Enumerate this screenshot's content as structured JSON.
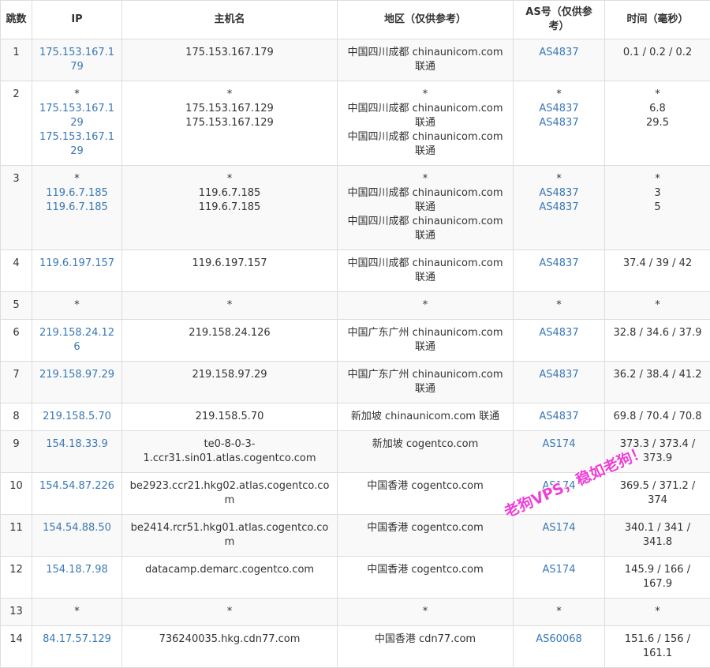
{
  "headers": {
    "hop": "跳数",
    "ip": "IP",
    "host": "主机名",
    "area": "地区（仅供参考）",
    "as": "AS号（仅供参考）",
    "time": "时间（毫秒）"
  },
  "rows": [
    {
      "hop": "1",
      "ip": [
        "175.153.167.179"
      ],
      "host": [
        "175.153.167.179"
      ],
      "area": [
        "中国四川成都 chinaunicom.com 联通"
      ],
      "as": [
        "AS4837"
      ],
      "time": [
        "0.1 / 0.2 / 0.2"
      ]
    },
    {
      "hop": "2",
      "ip": [
        "*",
        "175.153.167.129",
        "175.153.167.129"
      ],
      "host": [
        "*",
        "175.153.167.129",
        "175.153.167.129"
      ],
      "area": [
        "*",
        "中国四川成都 chinaunicom.com 联通",
        "中国四川成都 chinaunicom.com 联通"
      ],
      "as": [
        "*",
        "AS4837",
        "AS4837"
      ],
      "time": [
        "*",
        "6.8",
        "29.5"
      ]
    },
    {
      "hop": "3",
      "ip": [
        "*",
        "119.6.7.185",
        "119.6.7.185"
      ],
      "host": [
        "*",
        "119.6.7.185",
        "119.6.7.185"
      ],
      "area": [
        "*",
        "中国四川成都 chinaunicom.com 联通",
        "中国四川成都 chinaunicom.com 联通"
      ],
      "as": [
        "*",
        "AS4837",
        "AS4837"
      ],
      "time": [
        "*",
        "3",
        "5"
      ]
    },
    {
      "hop": "4",
      "ip": [
        "119.6.197.157"
      ],
      "host": [
        "119.6.197.157"
      ],
      "area": [
        "中国四川成都 chinaunicom.com 联通"
      ],
      "as": [
        "AS4837"
      ],
      "time": [
        "37.4 / 39 / 42"
      ]
    },
    {
      "hop": "5",
      "ip": [
        "*"
      ],
      "host": [
        "*"
      ],
      "area": [
        "*"
      ],
      "as": [
        "*"
      ],
      "time": [
        "*"
      ]
    },
    {
      "hop": "6",
      "ip": [
        "219.158.24.126"
      ],
      "host": [
        "219.158.24.126"
      ],
      "area": [
        "中国广东广州 chinaunicom.com 联通"
      ],
      "as": [
        "AS4837"
      ],
      "time": [
        "32.8 / 34.6 / 37.9"
      ]
    },
    {
      "hop": "7",
      "ip": [
        "219.158.97.29"
      ],
      "host": [
        "219.158.97.29"
      ],
      "area": [
        "中国广东广州 chinaunicom.com 联通"
      ],
      "as": [
        "AS4837"
      ],
      "time": [
        "36.2 / 38.4 / 41.2"
      ]
    },
    {
      "hop": "8",
      "ip": [
        "219.158.5.70"
      ],
      "host": [
        "219.158.5.70"
      ],
      "area": [
        "新加坡 chinaunicom.com 联通"
      ],
      "as": [
        "AS4837"
      ],
      "time": [
        "69.8 / 70.4 / 70.8"
      ]
    },
    {
      "hop": "9",
      "ip": [
        "154.18.33.9"
      ],
      "host": [
        "te0-8-0-3-1.ccr31.sin01.atlas.cogentco.com"
      ],
      "area": [
        "新加坡 cogentco.com"
      ],
      "as": [
        "AS174"
      ],
      "time": [
        "373.3 / 373.4 / 373.9"
      ]
    },
    {
      "hop": "10",
      "ip": [
        "154.54.87.226"
      ],
      "host": [
        "be2923.ccr21.hkg02.atlas.cogentco.com"
      ],
      "area": [
        "中国香港 cogentco.com"
      ],
      "as": [
        "AS174"
      ],
      "time": [
        "369.5 / 371.2 / 374"
      ]
    },
    {
      "hop": "11",
      "ip": [
        "154.54.88.50"
      ],
      "host": [
        "be2414.rcr51.hkg01.atlas.cogentco.com"
      ],
      "area": [
        "中国香港 cogentco.com"
      ],
      "as": [
        "AS174"
      ],
      "time": [
        "340.1 / 341 / 341.8"
      ]
    },
    {
      "hop": "12",
      "ip": [
        "154.18.7.98"
      ],
      "host": [
        "datacamp.demarc.cogentco.com"
      ],
      "area": [
        "中国香港 cogentco.com"
      ],
      "as": [
        "AS174"
      ],
      "time": [
        "145.9 / 166 / 167.9"
      ]
    },
    {
      "hop": "13",
      "ip": [
        "*"
      ],
      "host": [
        "*"
      ],
      "area": [
        "*"
      ],
      "as": [
        "*"
      ],
      "time": [
        "*"
      ]
    },
    {
      "hop": "14",
      "ip": [
        "84.17.57.129"
      ],
      "host": [
        "736240035.hkg.cdn77.com"
      ],
      "area": [
        "中国香港 cdn77.com"
      ],
      "as": [
        "AS60068"
      ],
      "time": [
        "151.6 / 156 / 161.1"
      ]
    }
  ],
  "watermark": "老狗VPS，稳如老狗！",
  "colors": {
    "link": "#3a78b5",
    "text": "#333333",
    "border": "#dddddd",
    "stripe": "#f9f9f9",
    "watermark": "#ee3fd6"
  }
}
